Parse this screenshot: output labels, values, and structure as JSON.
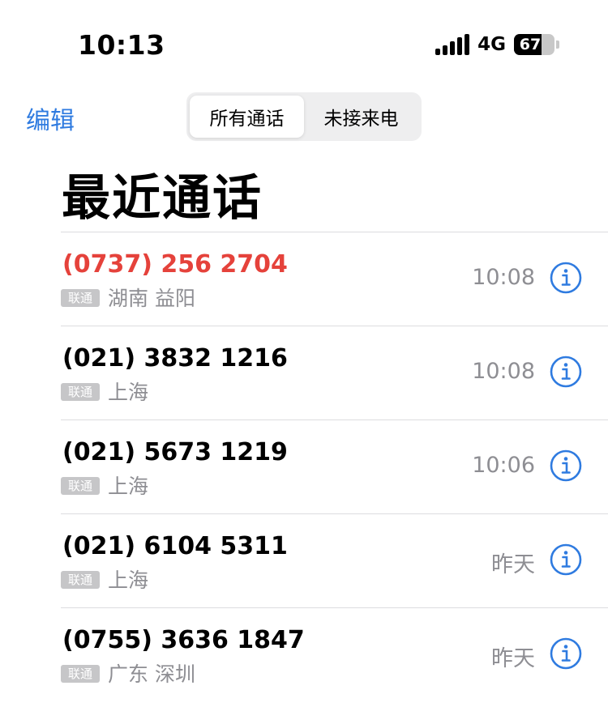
{
  "status_bar": {
    "time": "10:13",
    "network": "4G",
    "battery_level": "67",
    "battery_fraction": 0.67
  },
  "header": {
    "edit_label": "编辑",
    "segments": [
      {
        "label": "所有通话",
        "active": true
      },
      {
        "label": "未接来电",
        "active": false
      }
    ]
  },
  "title": "最近通话",
  "calls": [
    {
      "number": "(0737) 256 2704",
      "carrier": "联通",
      "location": "湖南 益阳",
      "time": "10:08",
      "missed": true
    },
    {
      "number": "(021) 3832 1216",
      "carrier": "联通",
      "location": "上海",
      "time": "10:08",
      "missed": false
    },
    {
      "number": "(021) 5673 1219",
      "carrier": "联通",
      "location": "上海",
      "time": "10:06",
      "missed": false
    },
    {
      "number": "(021) 6104 5311",
      "carrier": "联通",
      "location": "上海",
      "time": "昨天",
      "missed": false
    },
    {
      "number": "(0755) 3636 1847",
      "carrier": "联通",
      "location": "广东 深圳",
      "time": "昨天",
      "missed": false
    }
  ],
  "colors": {
    "accent": "#2F7BE0",
    "missed": "#E5423B",
    "secondary_text": "#8e8e93"
  },
  "icons": {
    "info": "info-circle-icon",
    "signal": "signal-bars-icon",
    "battery": "battery-icon"
  }
}
